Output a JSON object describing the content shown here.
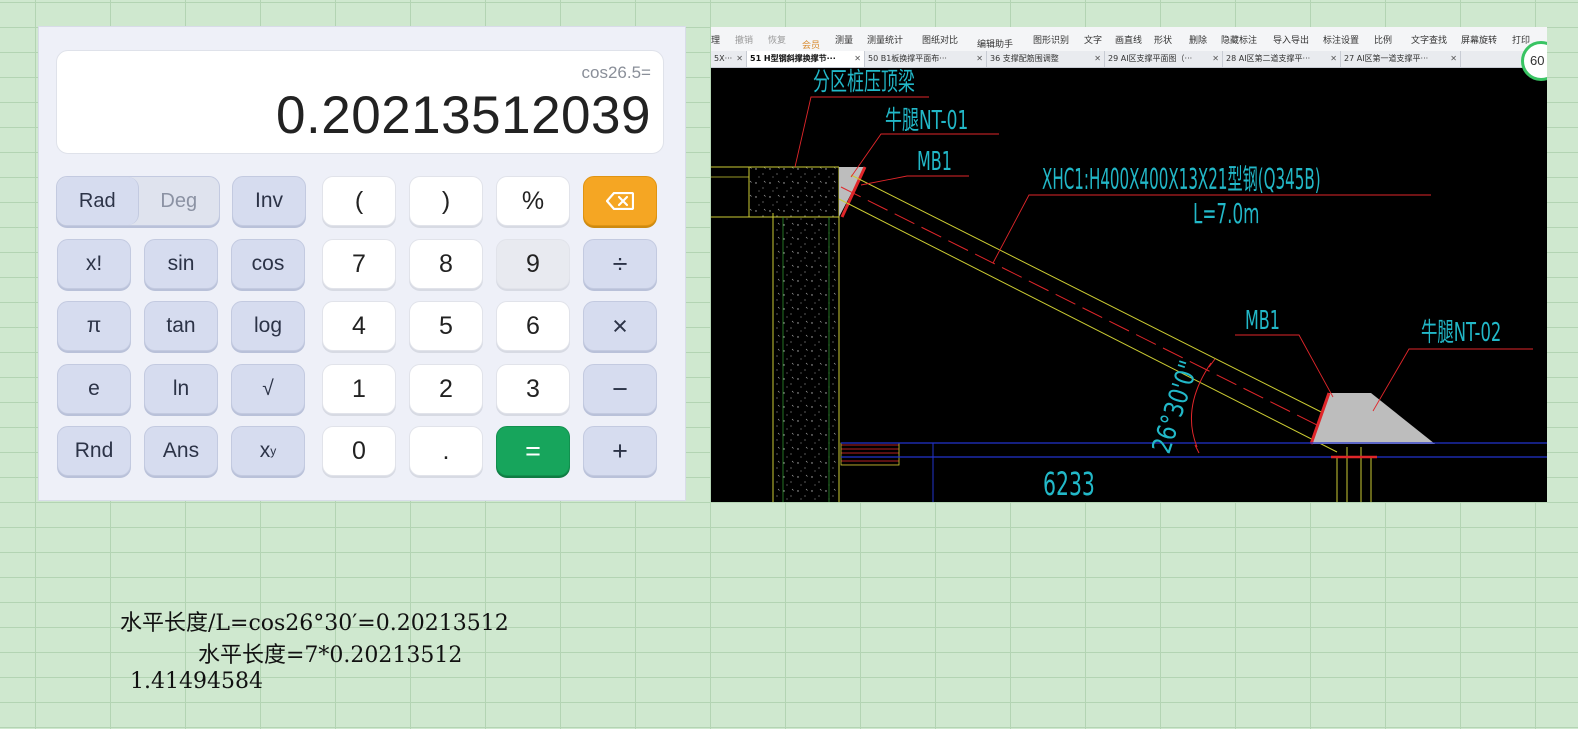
{
  "calculator": {
    "expression": "cos26.5=",
    "result": "0.20213512039",
    "mode_rad": "Rad",
    "mode_deg": "Deg",
    "keys": {
      "inv": "Inv",
      "lparen": "(",
      "rparen": ")",
      "percent": "%",
      "fact": "x!",
      "sin": "sin",
      "cos": "cos",
      "seven": "7",
      "eight": "8",
      "nine": "9",
      "div": "÷",
      "pi": "π",
      "tan": "tan",
      "log": "log",
      "four": "4",
      "five": "5",
      "six": "6",
      "mul": "×",
      "e": "e",
      "ln": "ln",
      "sqrt": "√",
      "one": "1",
      "two": "2",
      "three": "3",
      "minus": "−",
      "rnd": "Rnd",
      "ans": "Ans",
      "pow_base": "x",
      "pow_exp": "y",
      "zero": "0",
      "dot": ".",
      "equals": "=",
      "plus": "+"
    }
  },
  "cad": {
    "menu": {
      "m0": "理",
      "undo": "撤销",
      "redo": "恢复",
      "member": "会员",
      "measure": "测量",
      "measure_stats": "测量统计",
      "compare": "图纸对比",
      "edit_helper": "编辑助手",
      "shape_recog": "图形识别",
      "text": "文字",
      "line": "画直线",
      "shape": "形状",
      "delete": "删除",
      "hide_dim": "隐藏标注",
      "import_export": "导入导出",
      "dim_settings": "标注设置",
      "scale": "比例",
      "text_find": "文字查找",
      "screen_rotate": "屏幕旋转",
      "print": "打印"
    },
    "tabs": [
      "5X···",
      "51  H型钢斜撑换撑节···",
      "50  B1板换撑平面布···",
      "36  支撑配筋围调整",
      "29 AI区支撑平面图（···",
      "28  AI区第二道支撑平···",
      "27  AI区第一道支撑平···"
    ],
    "zoom": "60",
    "labels": {
      "zone_beam": "分区桩压顶梁",
      "corbel1": "牛腿NT-01",
      "mb1_top": "MB1",
      "member": "XHC1:H400X400X13X21型钢(Q345B)",
      "length": "L=7.0m",
      "mb1_bottom": "MB1",
      "corbel2": "牛腿NT-02",
      "angle": "26°30'0\"",
      "dimension": "6233"
    }
  },
  "notes": {
    "line1": "水平长度/L=cos26°30′=0.20213512",
    "line2": "水平长度=7*0.20213512",
    "line3": "1.41494584"
  },
  "colors": {
    "background_grid": "#cfe8cf",
    "equals_green": "#17a55c",
    "backspace_orange": "#f5a623",
    "cad_cyan": "#22b8c8",
    "cad_red": "#e0262a",
    "cad_yellow": "#cccc33"
  }
}
